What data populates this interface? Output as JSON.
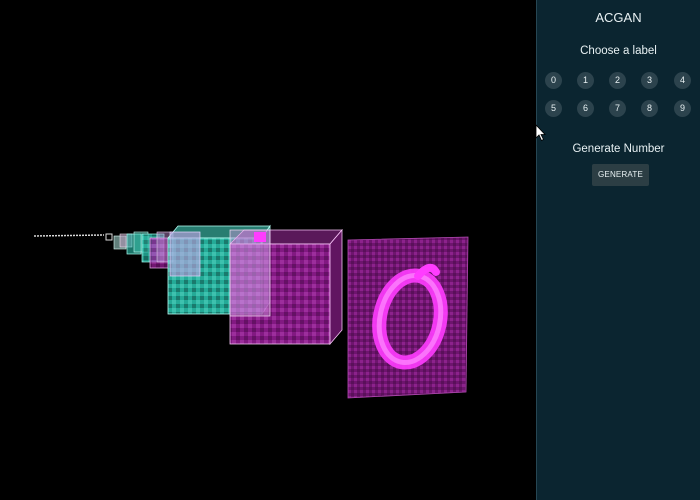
{
  "panel": {
    "title": "ACGAN",
    "choose_label": "Choose a label",
    "digits": [
      "0",
      "1",
      "2",
      "3",
      "4",
      "5",
      "6",
      "7",
      "8",
      "9"
    ],
    "generate_title": "Generate Number",
    "generate_button": "GENERATE"
  },
  "visualization": {
    "selected_digit": "0",
    "colors": {
      "background": "#000000",
      "teal_layer": "#2fd5bf",
      "magenta_layer": "#c837c8",
      "output_bg": "#7a1a7a",
      "output_digit": "#ff3cff"
    }
  }
}
